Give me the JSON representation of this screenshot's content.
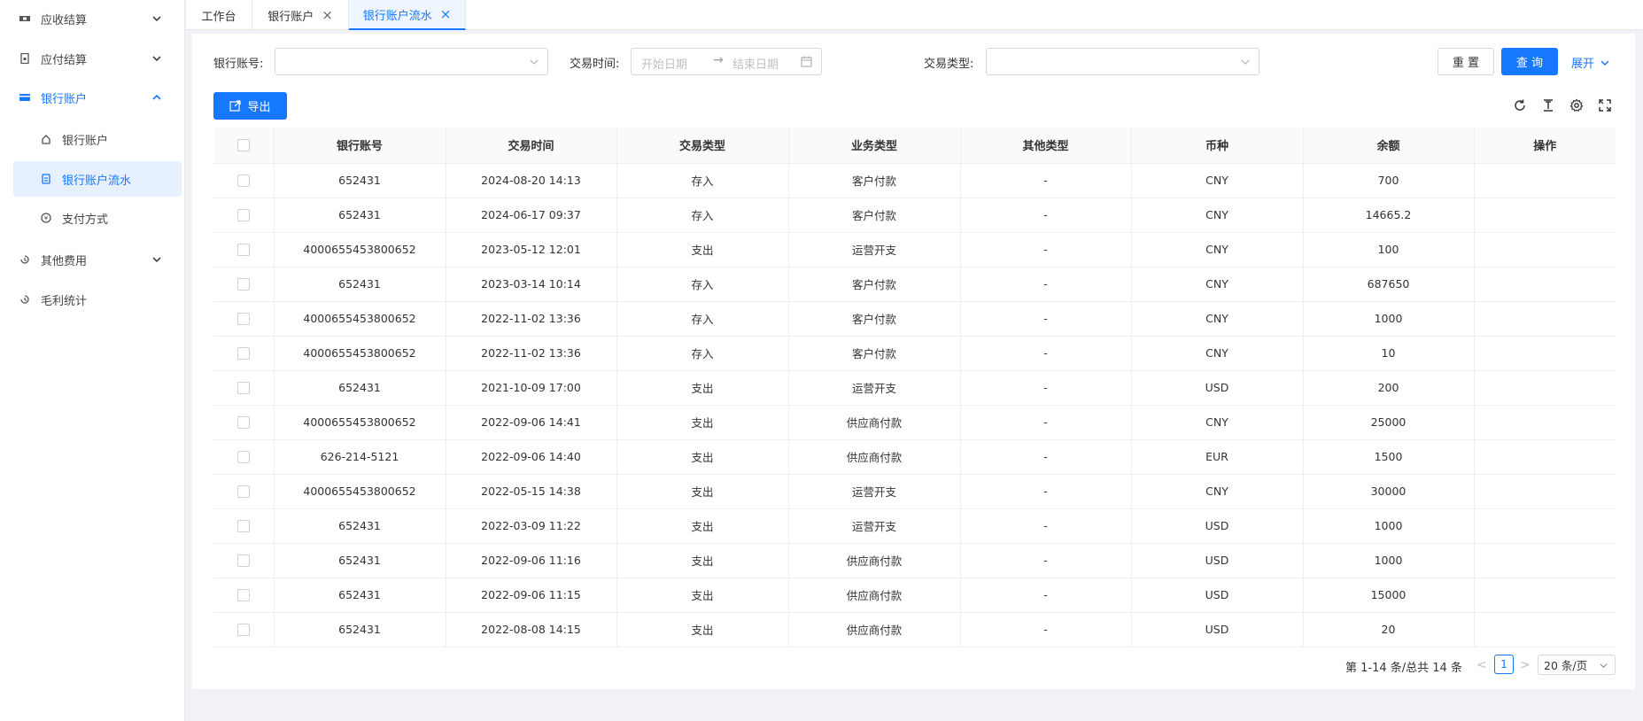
{
  "sidebar": {
    "items": [
      {
        "label": "应收结算",
        "icon": "receivable-icon",
        "expanded": false
      },
      {
        "label": "应付结算",
        "icon": "payable-icon",
        "expanded": false
      },
      {
        "label": "银行账户",
        "icon": "bank-card-icon",
        "expanded": true
      },
      {
        "label": "其他费用",
        "icon": "other-fee-icon",
        "expanded": false
      },
      {
        "label": "毛利统计",
        "icon": "profit-icon",
        "expanded": false
      }
    ],
    "sub_items": [
      {
        "label": "银行账户",
        "icon": "bank-icon"
      },
      {
        "label": "银行账户流水",
        "icon": "statement-icon",
        "active": true
      },
      {
        "label": "支付方式",
        "icon": "payment-icon"
      }
    ]
  },
  "tabs": [
    {
      "label": "工作台",
      "closable": false
    },
    {
      "label": "银行账户",
      "closable": true
    },
    {
      "label": "银行账户流水",
      "closable": true,
      "active": true
    }
  ],
  "filters": {
    "account_label": "银行账号:",
    "account_value": "",
    "time_label": "交易时间:",
    "start_placeholder": "开始日期",
    "end_placeholder": "结束日期",
    "range_arrow": "→",
    "type_label": "交易类型:",
    "type_value": "",
    "reset_label": "重 置",
    "query_label": "查 询",
    "expand_label": "展开"
  },
  "toolbar": {
    "export_label": "导出"
  },
  "table": {
    "columns": [
      "银行账号",
      "交易时间",
      "交易类型",
      "业务类型",
      "其他类型",
      "币种",
      "余额",
      "操作"
    ],
    "rows": [
      [
        "652431",
        "2024-08-20 14:13",
        "存入",
        "客户付款",
        "-",
        "CNY",
        "700",
        ""
      ],
      [
        "652431",
        "2024-06-17 09:37",
        "存入",
        "客户付款",
        "-",
        "CNY",
        "14665.2",
        ""
      ],
      [
        "4000655453800652",
        "2023-05-12 12:01",
        "支出",
        "运营开支",
        "-",
        "CNY",
        "100",
        ""
      ],
      [
        "652431",
        "2023-03-14 10:14",
        "存入",
        "客户付款",
        "-",
        "CNY",
        "687650",
        ""
      ],
      [
        "4000655453800652",
        "2022-11-02 13:36",
        "存入",
        "客户付款",
        "-",
        "CNY",
        "1000",
        ""
      ],
      [
        "4000655453800652",
        "2022-11-02 13:36",
        "存入",
        "客户付款",
        "-",
        "CNY",
        "10",
        ""
      ],
      [
        "652431",
        "2021-10-09 17:00",
        "支出",
        "运营开支",
        "-",
        "USD",
        "200",
        ""
      ],
      [
        "4000655453800652",
        "2022-09-06 14:41",
        "支出",
        "供应商付款",
        "-",
        "CNY",
        "25000",
        ""
      ],
      [
        "626-214-5121",
        "2022-09-06 14:40",
        "支出",
        "供应商付款",
        "-",
        "EUR",
        "1500",
        ""
      ],
      [
        "4000655453800652",
        "2022-05-15 14:38",
        "支出",
        "运营开支",
        "-",
        "CNY",
        "30000",
        ""
      ],
      [
        "652431",
        "2022-03-09 11:22",
        "支出",
        "运营开支",
        "-",
        "USD",
        "1000",
        ""
      ],
      [
        "652431",
        "2022-09-06 11:16",
        "支出",
        "供应商付款",
        "-",
        "USD",
        "1000",
        ""
      ],
      [
        "652431",
        "2022-09-06 11:15",
        "支出",
        "供应商付款",
        "-",
        "USD",
        "15000",
        ""
      ],
      [
        "652431",
        "2022-08-08 14:15",
        "支出",
        "供应商付款",
        "-",
        "USD",
        "20",
        ""
      ]
    ]
  },
  "pagination": {
    "total_text": "第 1-14 条/总共 14 条",
    "current_page": "1",
    "page_size": "20 条/页",
    "prev": "<",
    "next": ">"
  },
  "colors": {
    "accent": "#1677ff",
    "active_bg": "#e6f0ff"
  }
}
